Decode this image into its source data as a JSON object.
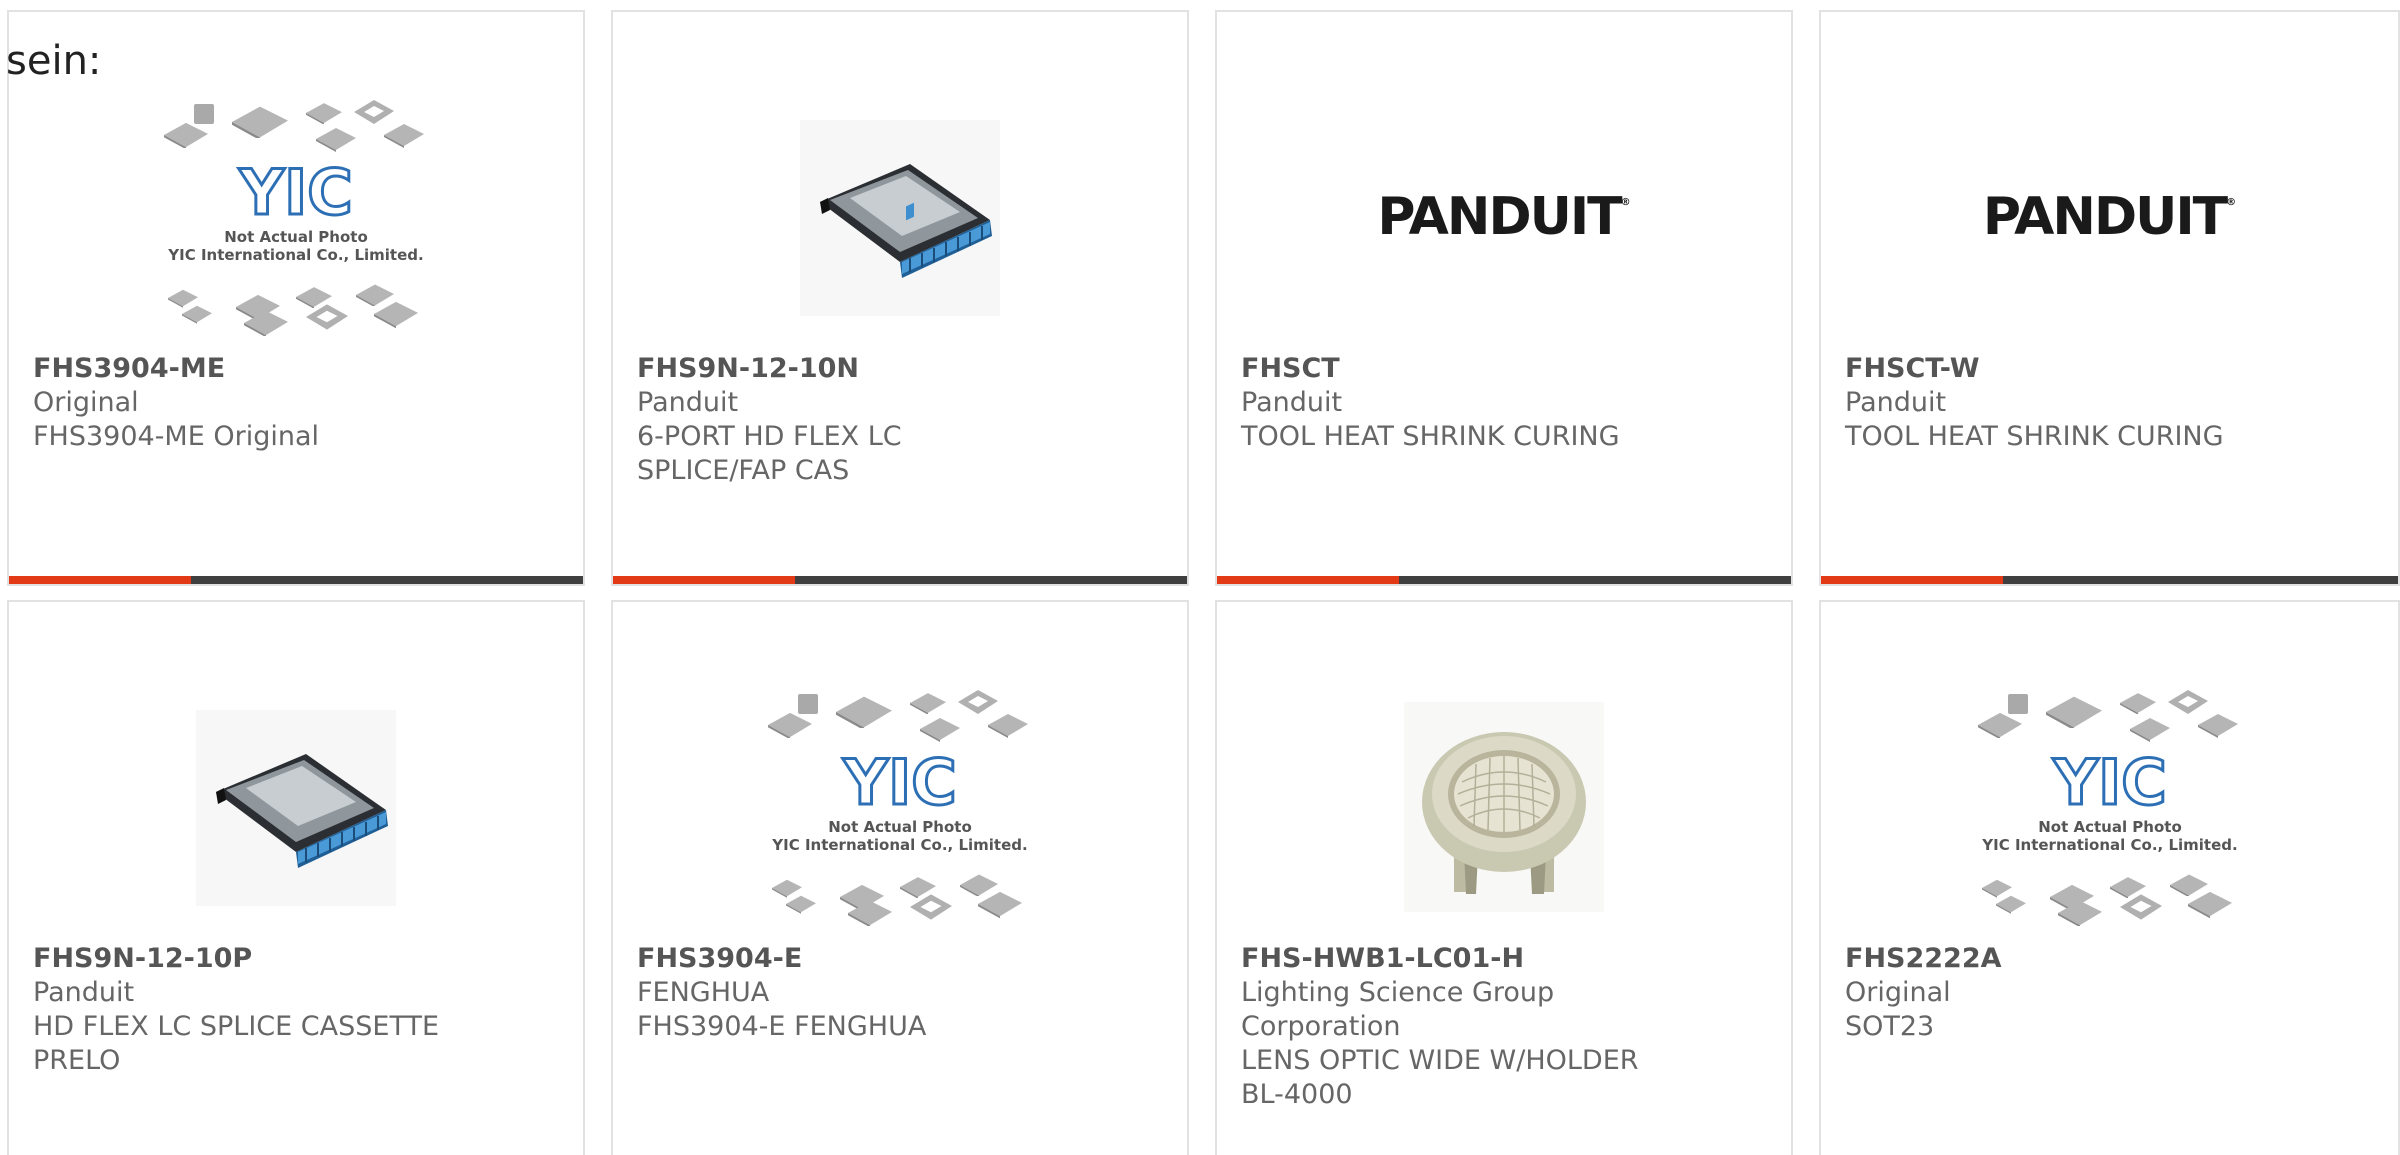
{
  "intro_text": "sein:",
  "colors": {
    "accent": "#e23a16",
    "bar_dark": "#3f3f3f",
    "card_border": "#e2e2e2",
    "ph_logo_blue": "#2d6fb5"
  },
  "placeholder": {
    "logo_text": "YIC",
    "caption_line1": "Not Actual Photo",
    "caption_line2": "YIC International Co., Limited."
  },
  "panduit_logo": {
    "text": "PANDUIT",
    "mark": "®"
  },
  "products": [
    {
      "part_number": "FHS3904-ME",
      "manufacturer": "Original",
      "description": "FHS3904-ME Original",
      "image": "yic-placeholder-image"
    },
    {
      "part_number": "FHS9N-12-10N",
      "manufacturer": "Panduit",
      "description": "6-PORT HD FLEX LC SPLICE/FAP CAS",
      "image": "fiber-cassette-image"
    },
    {
      "part_number": "FHSCT",
      "manufacturer": "Panduit",
      "description": "TOOL HEAT SHRINK CURING",
      "image": "panduit-logo-image"
    },
    {
      "part_number": "FHSCT-W",
      "manufacturer": "Panduit",
      "description": "TOOL HEAT SHRINK CURING",
      "image": "panduit-logo-image"
    },
    {
      "part_number": "FHS9N-12-10P",
      "manufacturer": "Panduit",
      "description": "HD FLEX LC SPLICE CASSETTE PRELO",
      "image": "fiber-cassette-image"
    },
    {
      "part_number": "FHS3904-E",
      "manufacturer": "FENGHUA",
      "description": "FHS3904-E FENGHUA",
      "image": "yic-placeholder-image"
    },
    {
      "part_number": "FHS-HWB1-LC01-H",
      "manufacturer": "Lighting Science Group Corporation",
      "description": "LENS OPTIC WIDE W/HOLDER BL-4000",
      "image": "led-lens-image"
    },
    {
      "part_number": "FHS2222A",
      "manufacturer": "Original",
      "description": "SOT23",
      "image": "yic-placeholder-image"
    }
  ]
}
